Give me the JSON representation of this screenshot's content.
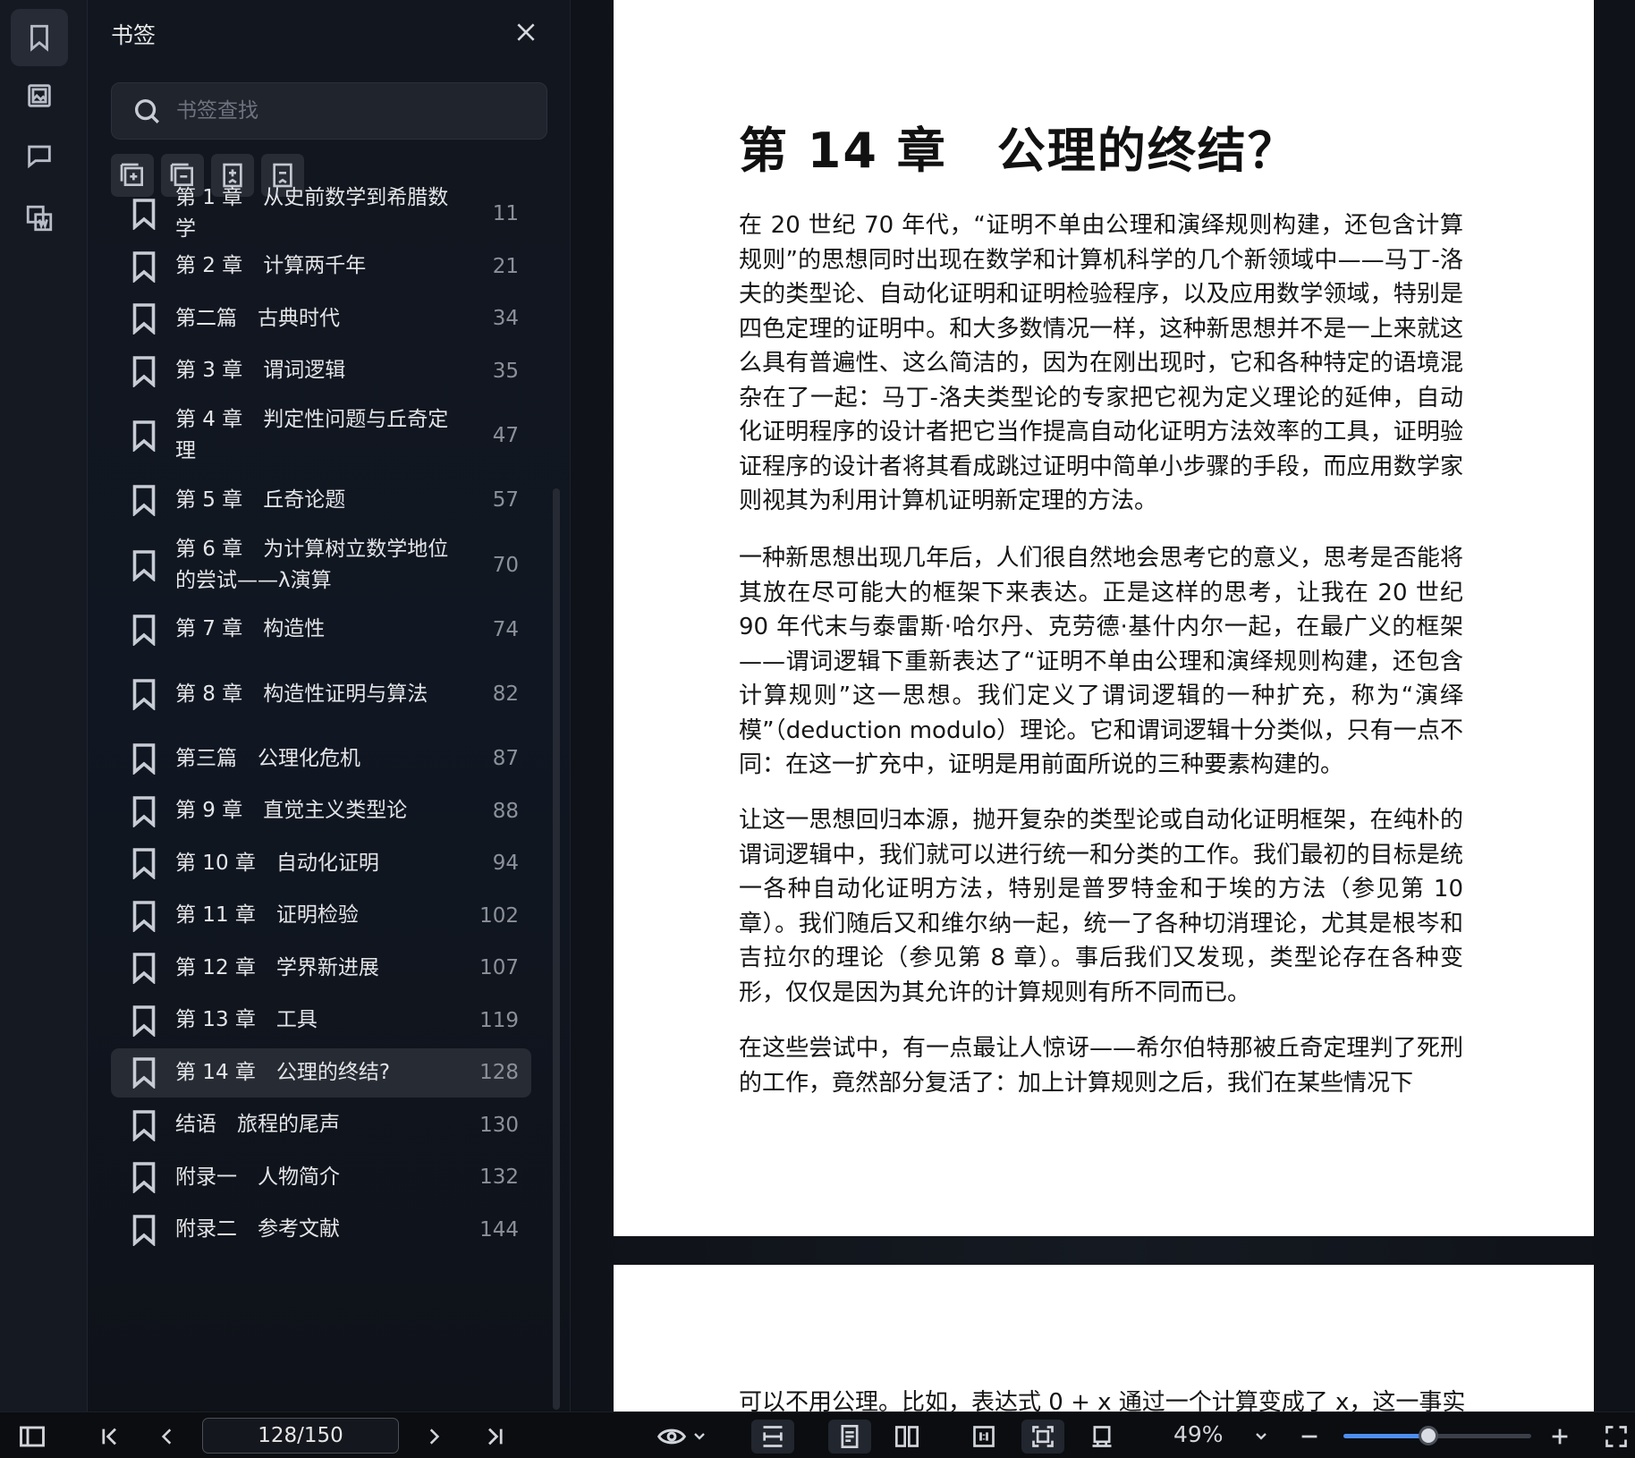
{
  "rail": {
    "items": [
      {
        "name": "bookmarks",
        "icon": "bookmark-icon",
        "active": true
      },
      {
        "name": "thumbnails",
        "icon": "image-icon",
        "active": false
      },
      {
        "name": "comments",
        "icon": "comment-icon",
        "active": false
      },
      {
        "name": "translate",
        "icon": "translate-icon",
        "active": false
      }
    ]
  },
  "panel": {
    "title": "书签",
    "search_placeholder": "书签查找",
    "items": [
      {
        "title": "第 1 章　从史前数学到希腊数学",
        "page": "11",
        "clipped": true
      },
      {
        "title": "第 2 章　计算两千年",
        "page": "21"
      },
      {
        "title": "第二篇　古典时代",
        "page": "34"
      },
      {
        "title": "第 3 章　谓词逻辑",
        "page": "35"
      },
      {
        "title": "第 4 章　判定性问题与丘奇定理",
        "page": "47"
      },
      {
        "title": "第 5 章　丘奇论题",
        "page": "57"
      },
      {
        "title": "第 6 章　为计算树立数学地位的尝试——λ演算",
        "page": "70"
      },
      {
        "title": "第 7 章　构造性",
        "page": "74"
      },
      {
        "title": "第 8 章　构造性证明与算法",
        "page": "82"
      },
      {
        "title": "第三篇　公理化危机",
        "page": "87"
      },
      {
        "title": "第 9 章　直觉主义类型论",
        "page": "88"
      },
      {
        "title": "第 10 章　自动化证明",
        "page": "94"
      },
      {
        "title": "第 11 章　证明检验",
        "page": "102"
      },
      {
        "title": "第 12 章　学界新进展",
        "page": "107"
      },
      {
        "title": "第 13 章　工具",
        "page": "119"
      },
      {
        "title": "第 14 章　公理的终结?",
        "page": "128",
        "active": true
      },
      {
        "title": "结语　旅程的尾声",
        "page": "130"
      },
      {
        "title": "附录一　人物简介",
        "page": "132"
      },
      {
        "title": "附录二　参考文献",
        "page": "144"
      }
    ]
  },
  "document": {
    "chapter_title": "第 14 章　公理的终结？",
    "paragraphs": [
      "在 20 世纪 70 年代，“证明不单由公理和演绎规则构建，还包含计算规则”的思想同时出现在数学和计算机科学的几个新领域中——马丁-洛夫的类型论、自动化证明和证明检验程序，以及应用数学领域，特别是四色定理的证明中。和大多数情况一样，这种新思想并不是一上来就这么具有普遍性、这么简洁的，因为在刚出现时，它和各种特定的语境混杂在了一起：马丁-洛夫类型论的专家把它视为定义理论的延伸，自动化证明程序的设计者把它当作提高自动化证明方法效率的工具，证明验证程序的设计者将其看成跳过证明中简单小步骤的手段，而应用数学家则视其为利用计算机证明新定理的方法。",
      "一种新思想出现几年后，人们很自然地会思考它的意义，思考是否能将其放在尽可能大的框架下来表达。正是这样的思考，让我在 20 世纪 90 年代末与泰雷斯·哈尔丹、克劳德·基什内尔一起，在最广义的框架——谓词逻辑下重新表达了“证明不单由公理和演绎规则构建，还包含计算规则”这一思想。我们定义了谓词逻辑的一种扩充，称为“演绎模”（deduction modulo）理论。它和谓词逻辑十分类似，只有一点不同：在这一扩充中，证明是用前面所说的三种要素构建的。",
      "让这一思想回归本源，抛开复杂的类型论或自动化证明框架，在纯朴的谓词逻辑中，我们就可以进行统一和分类的工作。我们最初的目标是统一各种自动化证明方法，特别是普罗特金和于埃的方法（参见第 10 章）。我们随后又和维尔纳一起，统一了各种切消理论，尤其是根岑和吉拉尔的理论（参见第 8 章）。事后我们又发现，类型论存在各种变形，仅仅是因为其允许的计算规则有所不同而已。",
      "在这些尝试中，有一点最让人惊讶——希尔伯特那被丘奇定理判了死刑的工作，竟然部分复活了：加上计算规则之后，我们在某些情况下"
    ],
    "next_page_line": "可以不用公理。比如，表达式 0 + x 通过一个计算变成了 x，这一事实"
  },
  "toolbar": {
    "page_indicator": "128/150",
    "current_page": 128,
    "total_pages": 150,
    "zoom": "49%",
    "zoom_value": 0.49
  }
}
